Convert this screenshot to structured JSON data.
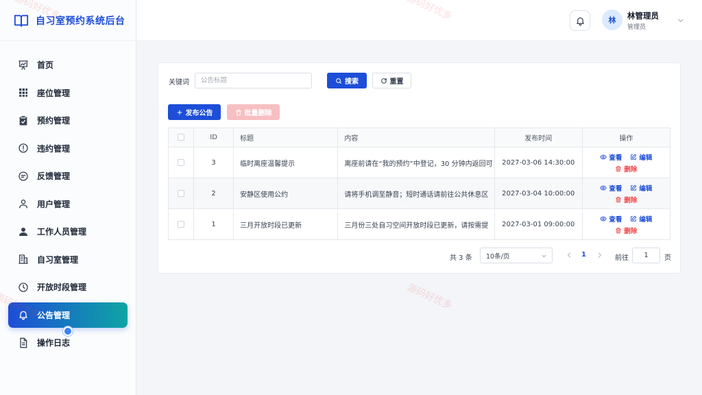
{
  "app": {
    "title": "自习室预约系统后台",
    "icon": "book-open-icon"
  },
  "sidebar": {
    "items": [
      {
        "label": "首页",
        "icon": "chart-board-icon",
        "active": false
      },
      {
        "label": "座位管理",
        "icon": "grid-icon",
        "active": false
      },
      {
        "label": "预约管理",
        "icon": "clipboard-check-icon",
        "active": false
      },
      {
        "label": "违约管理",
        "icon": "alert-circle-icon",
        "active": false
      },
      {
        "label": "反馈管理",
        "icon": "message-circle-icon",
        "active": false
      },
      {
        "label": "用户管理",
        "icon": "user-outline-icon",
        "active": false
      },
      {
        "label": "工作人员管理",
        "icon": "user-solid-icon",
        "active": false
      },
      {
        "label": "自习室管理",
        "icon": "building-icon",
        "active": false
      },
      {
        "label": "开放时段管理",
        "icon": "clock-icon",
        "active": false
      },
      {
        "label": "公告管理",
        "icon": "bell-icon",
        "active": true
      },
      {
        "label": "操作日志",
        "icon": "document-icon",
        "active": false
      }
    ]
  },
  "header": {
    "notification_icon": "bell-icon",
    "user": {
      "avatar_text": "林",
      "name": "林管理员",
      "role": "管理员"
    },
    "dropdown_icon": "chevron-down-icon"
  },
  "search": {
    "label": "关键词",
    "placeholder": "公告标题",
    "search_button": "搜索",
    "reset_button": "重置"
  },
  "actions": {
    "publish": "发布公告",
    "batch_delete": "批量删除"
  },
  "table": {
    "columns": [
      "ID",
      "标题",
      "内容",
      "发布时间",
      "操作"
    ],
    "rows": [
      {
        "id": "3",
        "title": "临时离座温馨提示",
        "content": "离座前请在“我的预约”中登记，30 分钟内返回可",
        "time": "2027-03-06 14:30:00"
      },
      {
        "id": "2",
        "title": "安静区使用公约",
        "content": "请将手机调至静音；短时通话请前往公共休息区",
        "time": "2027-03-04 10:00:00"
      },
      {
        "id": "1",
        "title": "三月开放时段已更新",
        "content": "三月份三处自习空间开放时段已更新，请按需提",
        "time": "2027-03-01 09:00:00"
      }
    ],
    "ops": {
      "view": "查看",
      "edit": "编辑",
      "delete": "删除"
    }
  },
  "pagination": {
    "total": "共 3 条",
    "page_size": "10条/页",
    "current_page": "1",
    "goto_label": "前往",
    "goto_value": "1",
    "goto_unit": "页"
  },
  "watermark": "源码好优多",
  "colors": {
    "primary": "#1d4ed8",
    "danger": "#ef4444",
    "active_gradient_end": "#0ea5a4"
  }
}
